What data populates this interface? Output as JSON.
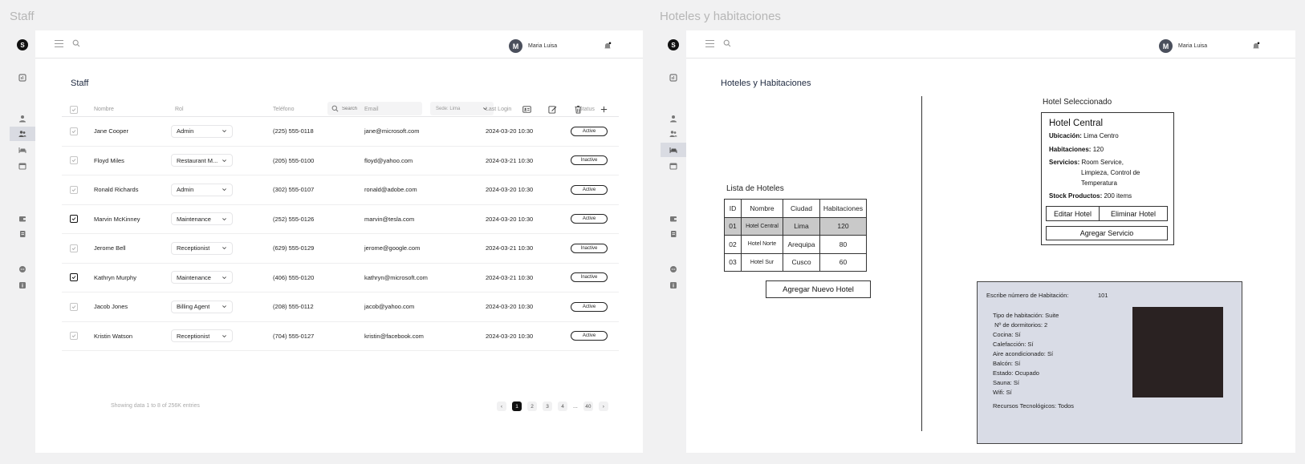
{
  "staff_frame": {
    "frame_title": "Staff",
    "logo": "S",
    "user": {
      "initial": "M",
      "name": "Maria Luisa"
    },
    "page_title": "Staff",
    "search_placeholder": "Search",
    "sede": "Sede: Lima",
    "columns": [
      "Nombre",
      "Rol",
      "Teléfono",
      "Email",
      "Last Login",
      "Status"
    ],
    "rows": [
      {
        "checked": false,
        "name": "Jane Cooper",
        "role": "Admin",
        "phone": "(225) 555-0118",
        "email": "jane@microsoft.com",
        "last_login": "2024-03-20 10:30",
        "status": "Active"
      },
      {
        "checked": false,
        "name": "Floyd Miles",
        "role": "Restaurant M...",
        "phone": "(205) 555-0100",
        "email": "floyd@yahoo.com",
        "last_login": "2024-03-21 10:30",
        "status": "Inactive"
      },
      {
        "checked": false,
        "name": "Ronald Richards",
        "role": "Admin",
        "phone": "(302) 555-0107",
        "email": "ronald@adobe.com",
        "last_login": "2024-03-20 10:30",
        "status": "Active"
      },
      {
        "checked": true,
        "name": "Marvin McKinney",
        "role": "Maintenance",
        "phone": "(252) 555-0126",
        "email": "marvin@tesla.com",
        "last_login": "2024-03-20 10:30",
        "status": "Active"
      },
      {
        "checked": false,
        "name": "Jerome Bell",
        "role": "Receptionist",
        "phone": "(629) 555-0129",
        "email": "jerome@google.com",
        "last_login": "2024-03-21 10:30",
        "status": "Inactive"
      },
      {
        "checked": true,
        "name": "Kathryn Murphy",
        "role": "Maintenance",
        "phone": "(406) 555-0120",
        "email": "kathryn@microsoft.com",
        "last_login": "2024-03-21 10:30",
        "status": "Inactive"
      },
      {
        "checked": false,
        "name": "Jacob Jones",
        "role": "Billing Agent",
        "phone": "(208) 555-0112",
        "email": "jacob@yahoo.com",
        "last_login": "2024-03-20 10:30",
        "status": "Active"
      },
      {
        "checked": false,
        "name": "Kristin Watson",
        "role": "Receptionist",
        "phone": "(704) 555-0127",
        "email": "kristin@facebook.com",
        "last_login": "2024-03-20 10:30",
        "status": "Active"
      }
    ],
    "footer_info": "Showing data 1 to 8 of  256K entries",
    "pagination": {
      "prev": "‹",
      "pages": [
        "1",
        "2",
        "3",
        "4"
      ],
      "ellipsis": "...",
      "last": "40",
      "next": "›",
      "current": "1"
    }
  },
  "hotels_frame": {
    "frame_title": "Hoteles y habitaciones",
    "logo": "S",
    "user": {
      "initial": "M",
      "name": "Maria Luisa"
    },
    "page_title": "Hoteles y Habitaciones",
    "list_title": "Lista de Hoteles",
    "table_headers": [
      "ID",
      "Nombre",
      "Ciudad",
      "Habitaciones"
    ],
    "hotels": [
      {
        "id": "01",
        "name": "Hotel Central",
        "city": "Lima",
        "rooms": "120",
        "selected": true
      },
      {
        "id": "02",
        "name": "Hotel Norte",
        "city": "Arequipa",
        "rooms": "80",
        "selected": false
      },
      {
        "id": "03",
        "name": "Hotel Sur",
        "city": "Cusco",
        "rooms": "60",
        "selected": false
      }
    ],
    "add_hotel_button": "Agregar Nuevo Hotel",
    "selected_title": "Hotel Seleccionado",
    "selected_hotel": {
      "name": "Hotel Central",
      "location_label": "Ubicación:",
      "location": "Lima Centro",
      "rooms_label": "Habitaciones:",
      "rooms": "120",
      "services_label": "Servicios:",
      "services_line1": "Room Service,",
      "services_line2": "Limpieza, Control de",
      "services_line3": "Temperatura",
      "stock_label": "Stock Productos:",
      "stock": "200 items"
    },
    "edit_button": "Editar Hotel",
    "delete_button": "Eliminar Hotel",
    "add_service_button": "Agregar Servicio",
    "room_panel": {
      "prompt": "Escribe número de Habitación:",
      "room_number": "101",
      "details": [
        "Tipo de habitación: Suite",
        " Nº de dormitorios: 2",
        "Cocina: Sí",
        "Calefacción: Sí",
        "Aire acondicionado: Sí",
        "Balcón: Sí",
        "Estado: Ocupado",
        "Sauna: Sí",
        "Wifi: Sí"
      ],
      "resources": "Recursos Tecnológicos: Todos"
    }
  }
}
